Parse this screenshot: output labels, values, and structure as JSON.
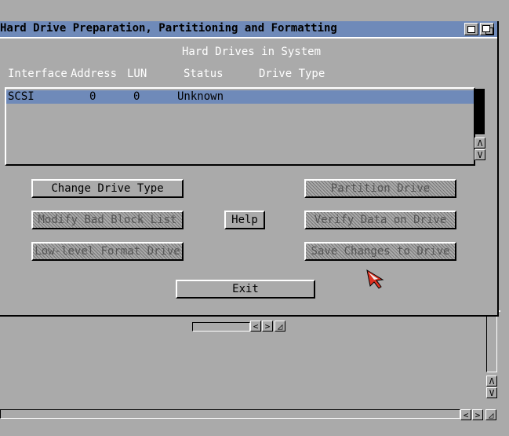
{
  "window": {
    "title": "Hard Drive Preparation, Partitioning and Formatting"
  },
  "list": {
    "heading": "Hard Drives in System",
    "columns": [
      "Interface",
      "Address",
      "LUN",
      "Status",
      "Drive Type"
    ],
    "rows": [
      {
        "interface": "SCSI",
        "address": "0",
        "lun": "0",
        "status": "Unknown",
        "drive_type": ""
      }
    ]
  },
  "buttons": {
    "change_drive_type": "Change Drive Type",
    "modify_bad_block_list": "Modify Bad Block List",
    "low_level_format": "Low-level Format Drive",
    "help": "Help",
    "partition_drive": "Partition Drive",
    "verify_data": "Verify Data on Drive",
    "save_changes": "Save Changes to Drive",
    "exit": "Exit"
  },
  "glyphs": {
    "up": "Λ",
    "down": "V",
    "left": "<",
    "right": ">",
    "resize": "◿"
  },
  "colors": {
    "background": "#aaaaaa",
    "titlebar": "#6f8ab9",
    "selection": "#6f8ab9",
    "pointer": "#e03020"
  }
}
